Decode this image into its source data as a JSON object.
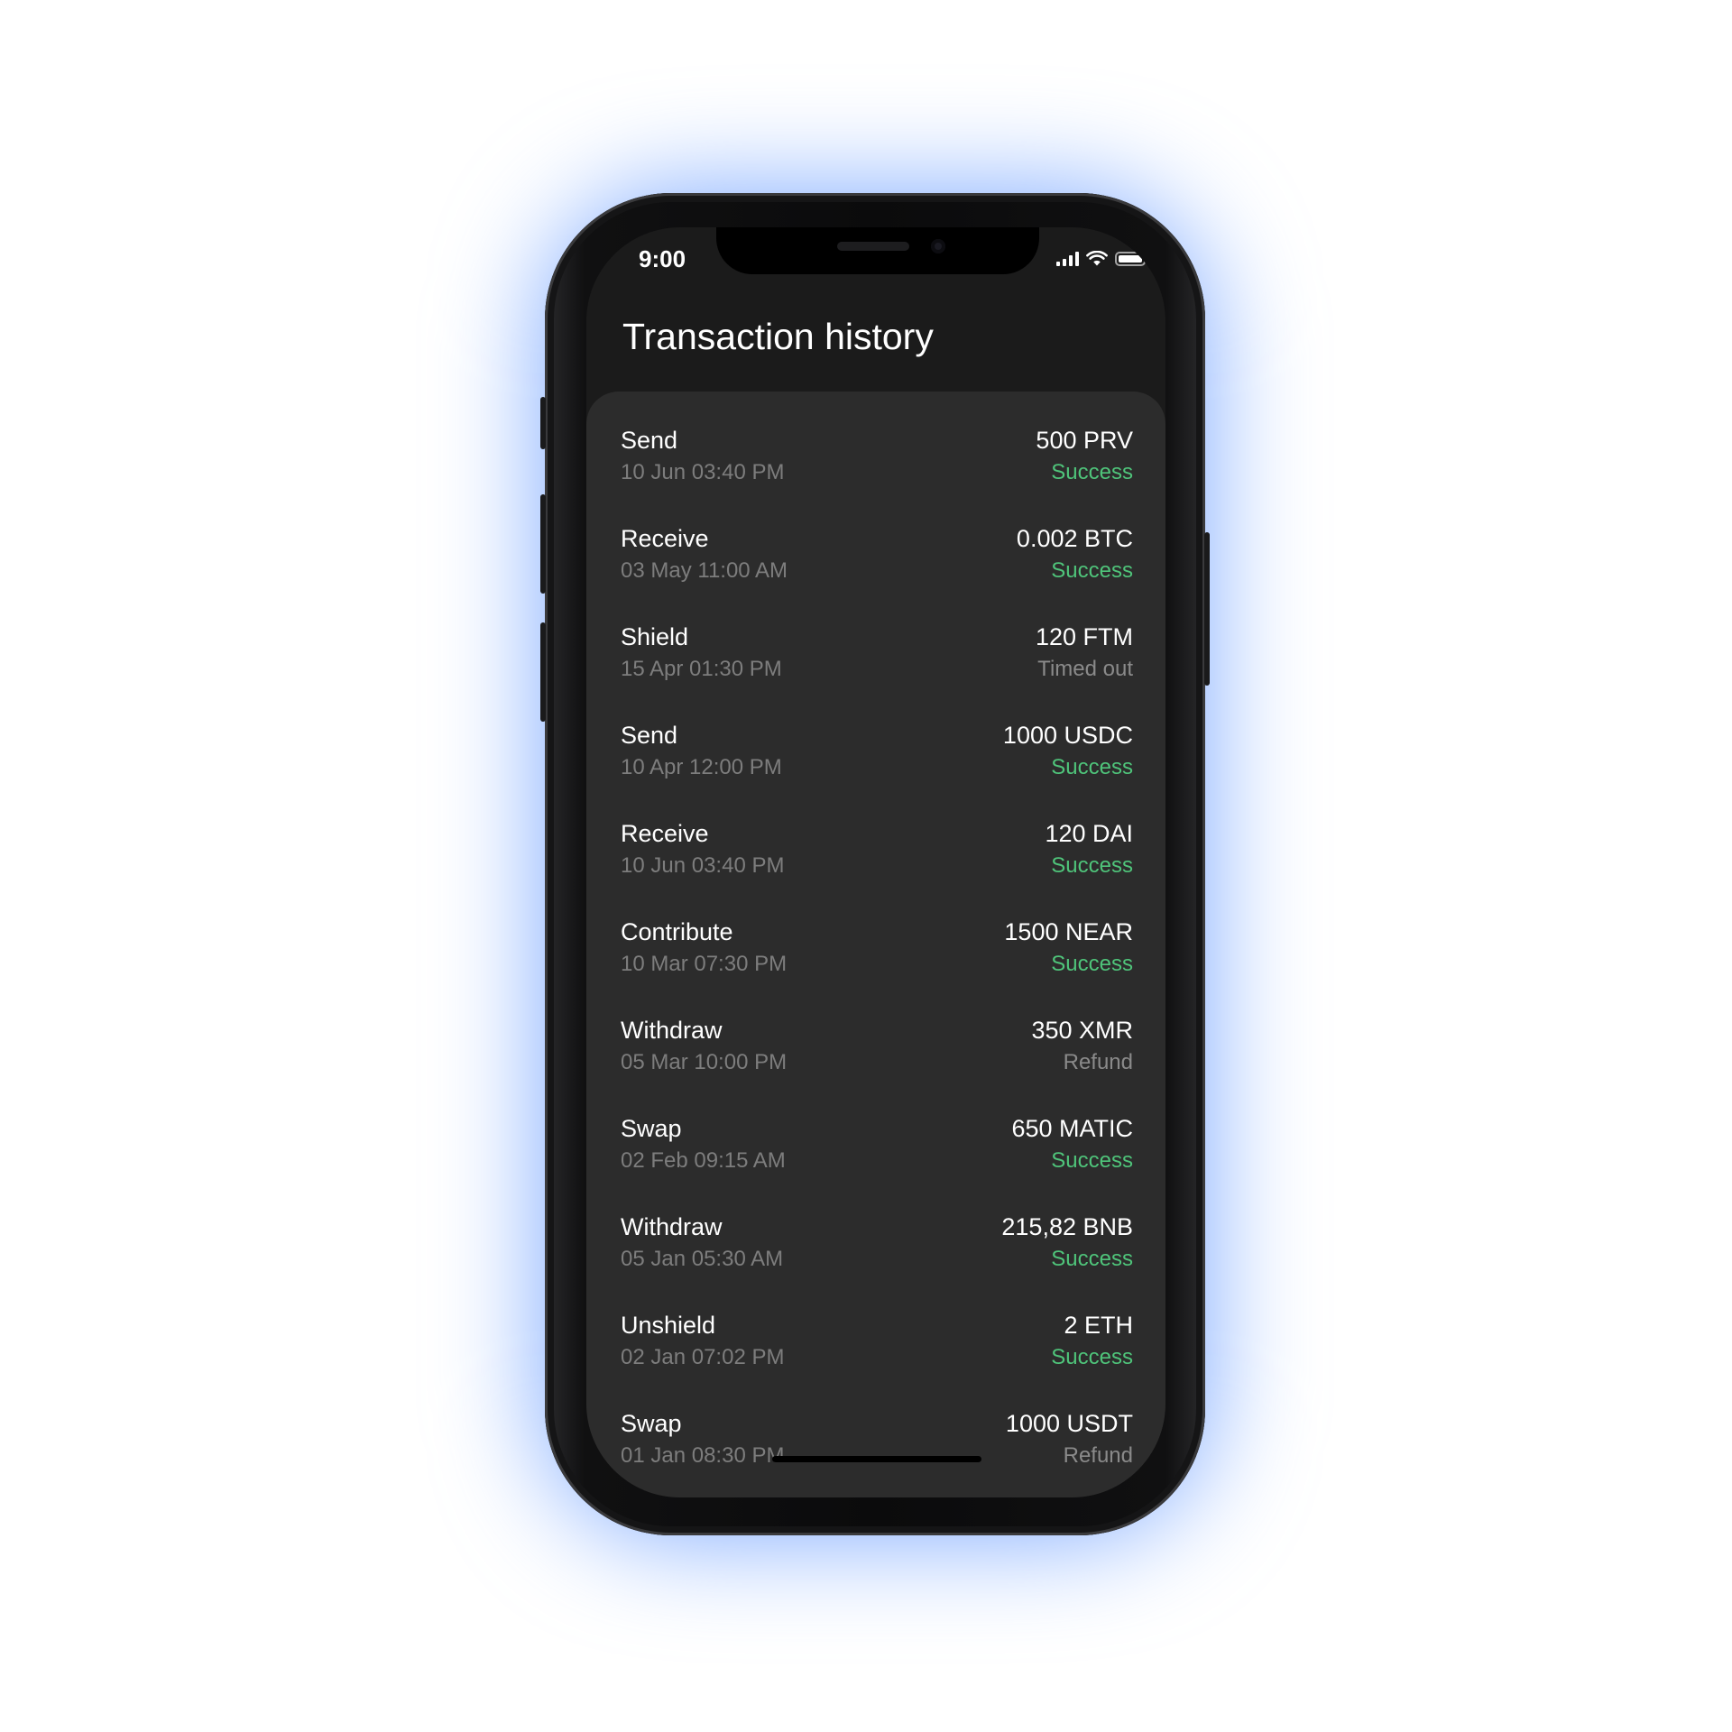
{
  "status_bar": {
    "time": "9:00",
    "icons": [
      "cellular-signal-icon",
      "wifi-icon",
      "battery-icon"
    ]
  },
  "header": {
    "title": "Transaction history"
  },
  "colors": {
    "background": "#1b1b1b",
    "card": "#2c2c2c",
    "success": "#4fc47a",
    "neutral_status": "#8a8a8a",
    "glow": "#6096ff"
  },
  "transactions": [
    {
      "type": "Send",
      "date": "10 Jun 03:40 PM",
      "amount": "500 PRV",
      "status": "Success",
      "status_color": "#4fc47a"
    },
    {
      "type": "Receive",
      "date": "03 May 11:00 AM",
      "amount": "0.002 BTC",
      "status": "Success",
      "status_color": "#4fc47a"
    },
    {
      "type": "Shield",
      "date": "15 Apr 01:30 PM",
      "amount": "120 FTM",
      "status": "Timed out",
      "status_color": "#8a8a8a"
    },
    {
      "type": "Send",
      "date": "10 Apr 12:00 PM",
      "amount": "1000 USDC",
      "status": "Success",
      "status_color": "#4fc47a"
    },
    {
      "type": "Receive",
      "date": "10 Jun 03:40 PM",
      "amount": "120 DAI",
      "status": "Success",
      "status_color": "#4fc47a"
    },
    {
      "type": "Contribute",
      "date": "10 Mar 07:30 PM",
      "amount": "1500 NEAR",
      "status": "Success",
      "status_color": "#4fc47a"
    },
    {
      "type": "Withdraw",
      "date": "05 Mar 10:00 PM",
      "amount": "350 XMR",
      "status": "Refund",
      "status_color": "#8a8a8a"
    },
    {
      "type": "Swap",
      "date": "02 Feb 09:15 AM",
      "amount": "650 MATIC",
      "status": "Success",
      "status_color": "#4fc47a"
    },
    {
      "type": "Withdraw",
      "date": "05 Jan 05:30 AM",
      "amount": "215,82 BNB",
      "status": "Success",
      "status_color": "#4fc47a"
    },
    {
      "type": "Unshield",
      "date": "02 Jan 07:02 PM",
      "amount": "2 ETH",
      "status": "Success",
      "status_color": "#4fc47a"
    },
    {
      "type": "Swap",
      "date": "01 Jan 08:30 PM",
      "amount": "1000 USDT",
      "status": "Refund",
      "status_color": "#8a8a8a"
    }
  ]
}
